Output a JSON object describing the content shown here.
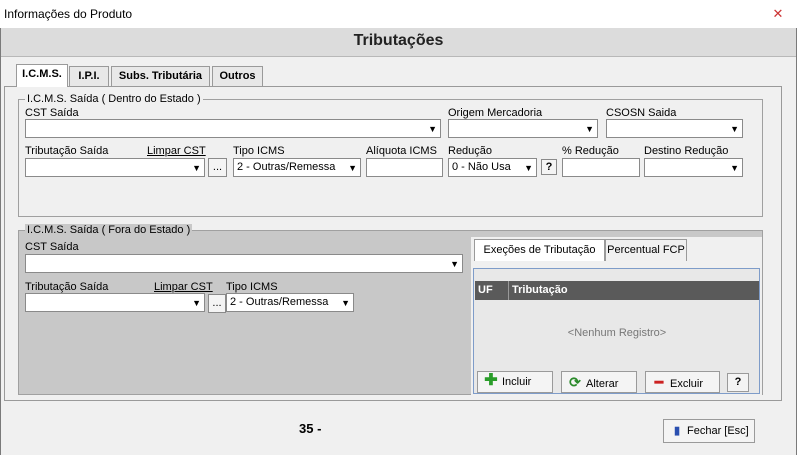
{
  "window": {
    "title": "Informações do Produto",
    "close_glyph": "✕"
  },
  "header": {
    "title": "Tributações"
  },
  "tabs": [
    {
      "label": "I.C.M.S."
    },
    {
      "label": "I.P.I."
    },
    {
      "label": "Subs. Tributária"
    },
    {
      "label": "Outros"
    }
  ],
  "dentro": {
    "legend": "I.C.M.S. Saída ( Dentro do Estado )",
    "cst_label": "CST Saída",
    "cst_value": "",
    "origem_label": "Origem Mercadoria",
    "origem_value": "",
    "csosn_label": "CSOSN Saida",
    "csosn_value": "",
    "trib_label": "Tributação Saída",
    "trib_value": "",
    "limpar_label": "Limpar CST",
    "tipo_label": "Tipo ICMS",
    "tipo_value": "2 - Outras/Remessa",
    "aliquota_label": "Alíquota ICMS",
    "aliquota_value": "",
    "reducao_label": "Redução",
    "reducao_value": "0 - Não Usa",
    "perc_label": "% Redução",
    "perc_value": "",
    "destino_label": "Destino Redução",
    "destino_value": ""
  },
  "fora": {
    "legend": "I.C.M.S. Saída ( Fora do Estado )",
    "cst_label": "CST Saída",
    "cst_value": "",
    "trib_label": "Tributação Saída",
    "trib_value": "",
    "limpar_label": "Limpar CST",
    "tipo_label": "Tipo ICMS",
    "tipo_value": "2 - Outras/Remessa"
  },
  "ellipsis": "...",
  "help": "?",
  "excecoes": {
    "tabs": [
      {
        "label": "Exeções de Tributação"
      },
      {
        "label": "Percentual FCP"
      }
    ],
    "columns": [
      "UF",
      "Tributação"
    ],
    "empty": "<Nenhum Registro>",
    "incluir": "Incluir",
    "alterar": "Alterar",
    "excluir": "Excluir",
    "help": "?"
  },
  "footer": {
    "counter": "35 -",
    "fechar": "Fechar [Esc]"
  },
  "colors": {
    "add_icon": "#2a9d2a",
    "refresh_icon": "#2a8a2a",
    "delete_icon": "#cc2222",
    "grid_header": "#5a5a5a",
    "panel_border": "#7e9cc9"
  }
}
